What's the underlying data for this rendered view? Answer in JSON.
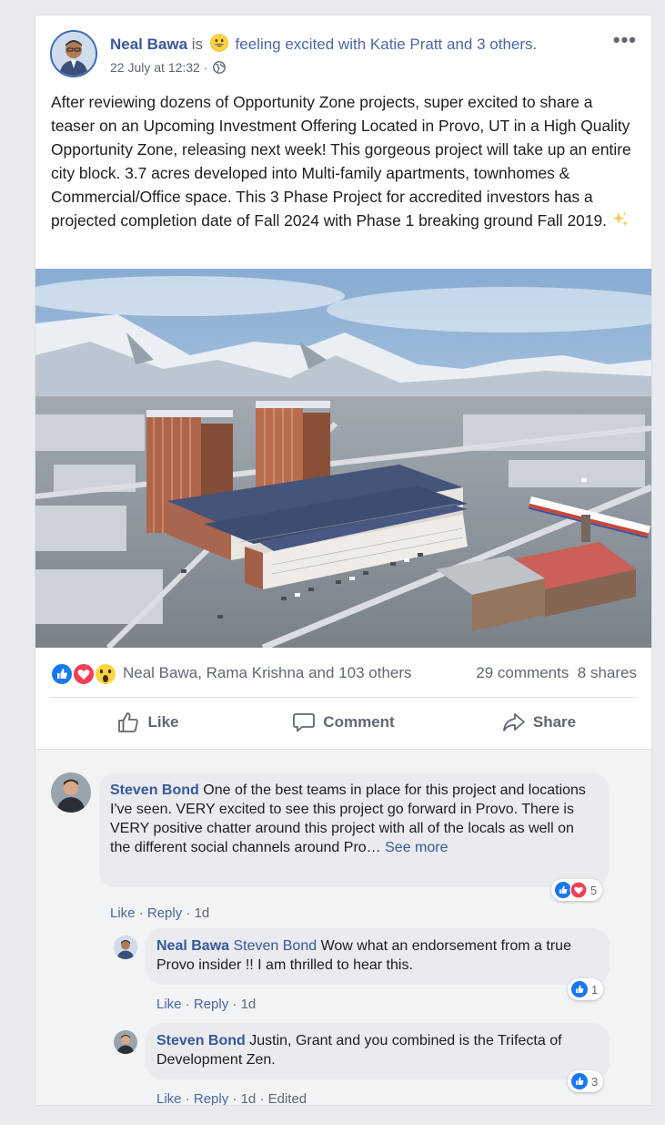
{
  "post": {
    "author": "Neal Bawa",
    "is_text": "is",
    "feeling_text": "feeling excited with",
    "tagged_primary": "Katie Pratt",
    "tagged_and": "and",
    "tagged_others": "3 others.",
    "timestamp": "22 July at 12:32",
    "timestamp_sep": "·",
    "more_label": "•••",
    "body": "After reviewing dozens of Opportunity Zone projects, super excited to share a teaser on an Upcoming Investment Offering Located in Provo, UT in a High Quality Opportunity Zone, releasing next week! This gorgeous project will take up an entire city block. 3.7 acres developed into Multi-family apartments, townhomes & Commercial/Office space. This 3 Phase Project for accredited investors has a projected completion date of Fall 2024 with Phase 1 breaking ground Fall 2019.",
    "reactions_names": "Neal Bawa, Rama Krishna and 103 others",
    "comments_count": "29 comments",
    "shares_count": "8 shares"
  },
  "actions": {
    "like": "Like",
    "comment": "Comment",
    "share": "Share"
  },
  "colors": {
    "link_blue": "#385898",
    "like_blue": "#1877f2",
    "love_red": "#f33e58",
    "wow_yellow": "#fcd53f"
  },
  "comments": [
    {
      "author": "Steven Bond",
      "text": "One of the best teams in place for this project and locations I've seen. VERY excited to see this project go forward in Provo. There is VERY positive chatter around this project with all of the locals as well on the different social channels around Pro…",
      "see_more": "See more",
      "like": "Like",
      "reply": "Reply",
      "sep": "·",
      "age": "1d",
      "reaction_count": "5"
    },
    {
      "author": "Neal Bawa",
      "tag": "Steven Bond",
      "text": "Wow what an endorsement from a true Provo insider !! I am thrilled to hear this.",
      "like": "Like",
      "reply": "Reply",
      "sep": "·",
      "age": "1d",
      "reaction_count": "1"
    },
    {
      "author": "Steven Bond",
      "text": "Justin, Grant and you combined is the Trifecta of Development Zen.",
      "like": "Like",
      "reply": "Reply",
      "sep": "·",
      "age": "1d",
      "edited": "Edited",
      "reaction_count": "3"
    }
  ]
}
